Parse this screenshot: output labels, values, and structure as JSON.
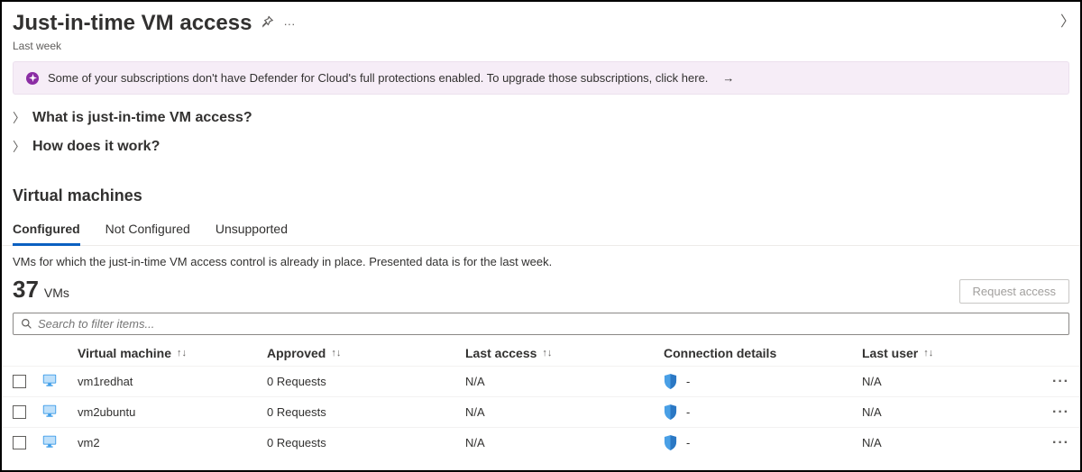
{
  "header": {
    "title": "Just-in-time VM access",
    "subtitle": "Last week"
  },
  "banner": {
    "text": "Some of your subscriptions don't have Defender for Cloud's full protections enabled. To upgrade those subscriptions, click here."
  },
  "expandos": {
    "what": "What is just-in-time VM access?",
    "how": "How does it work?"
  },
  "section": {
    "title": "Virtual machines"
  },
  "tabs": {
    "configured": "Configured",
    "not_configured": "Not Configured",
    "unsupported": "Unsupported"
  },
  "tab_desc": "VMs for which the just-in-time VM access control is already in place. Presented data is for the last week.",
  "count": {
    "value": "37",
    "unit": "VMs"
  },
  "buttons": {
    "request_access": "Request access"
  },
  "search": {
    "placeholder": "Search to filter items..."
  },
  "columns": {
    "vm": "Virtual machine",
    "approved": "Approved",
    "last_access": "Last access",
    "connection": "Connection details",
    "last_user": "Last user"
  },
  "rows": [
    {
      "name": "vm1redhat",
      "approved": "0 Requests",
      "last_access": "N/A",
      "connection": "-",
      "last_user": "N/A"
    },
    {
      "name": "vm2ubuntu",
      "approved": "0 Requests",
      "last_access": "N/A",
      "connection": "-",
      "last_user": "N/A"
    },
    {
      "name": "vm2",
      "approved": "0 Requests",
      "last_access": "N/A",
      "connection": "-",
      "last_user": "N/A"
    }
  ]
}
